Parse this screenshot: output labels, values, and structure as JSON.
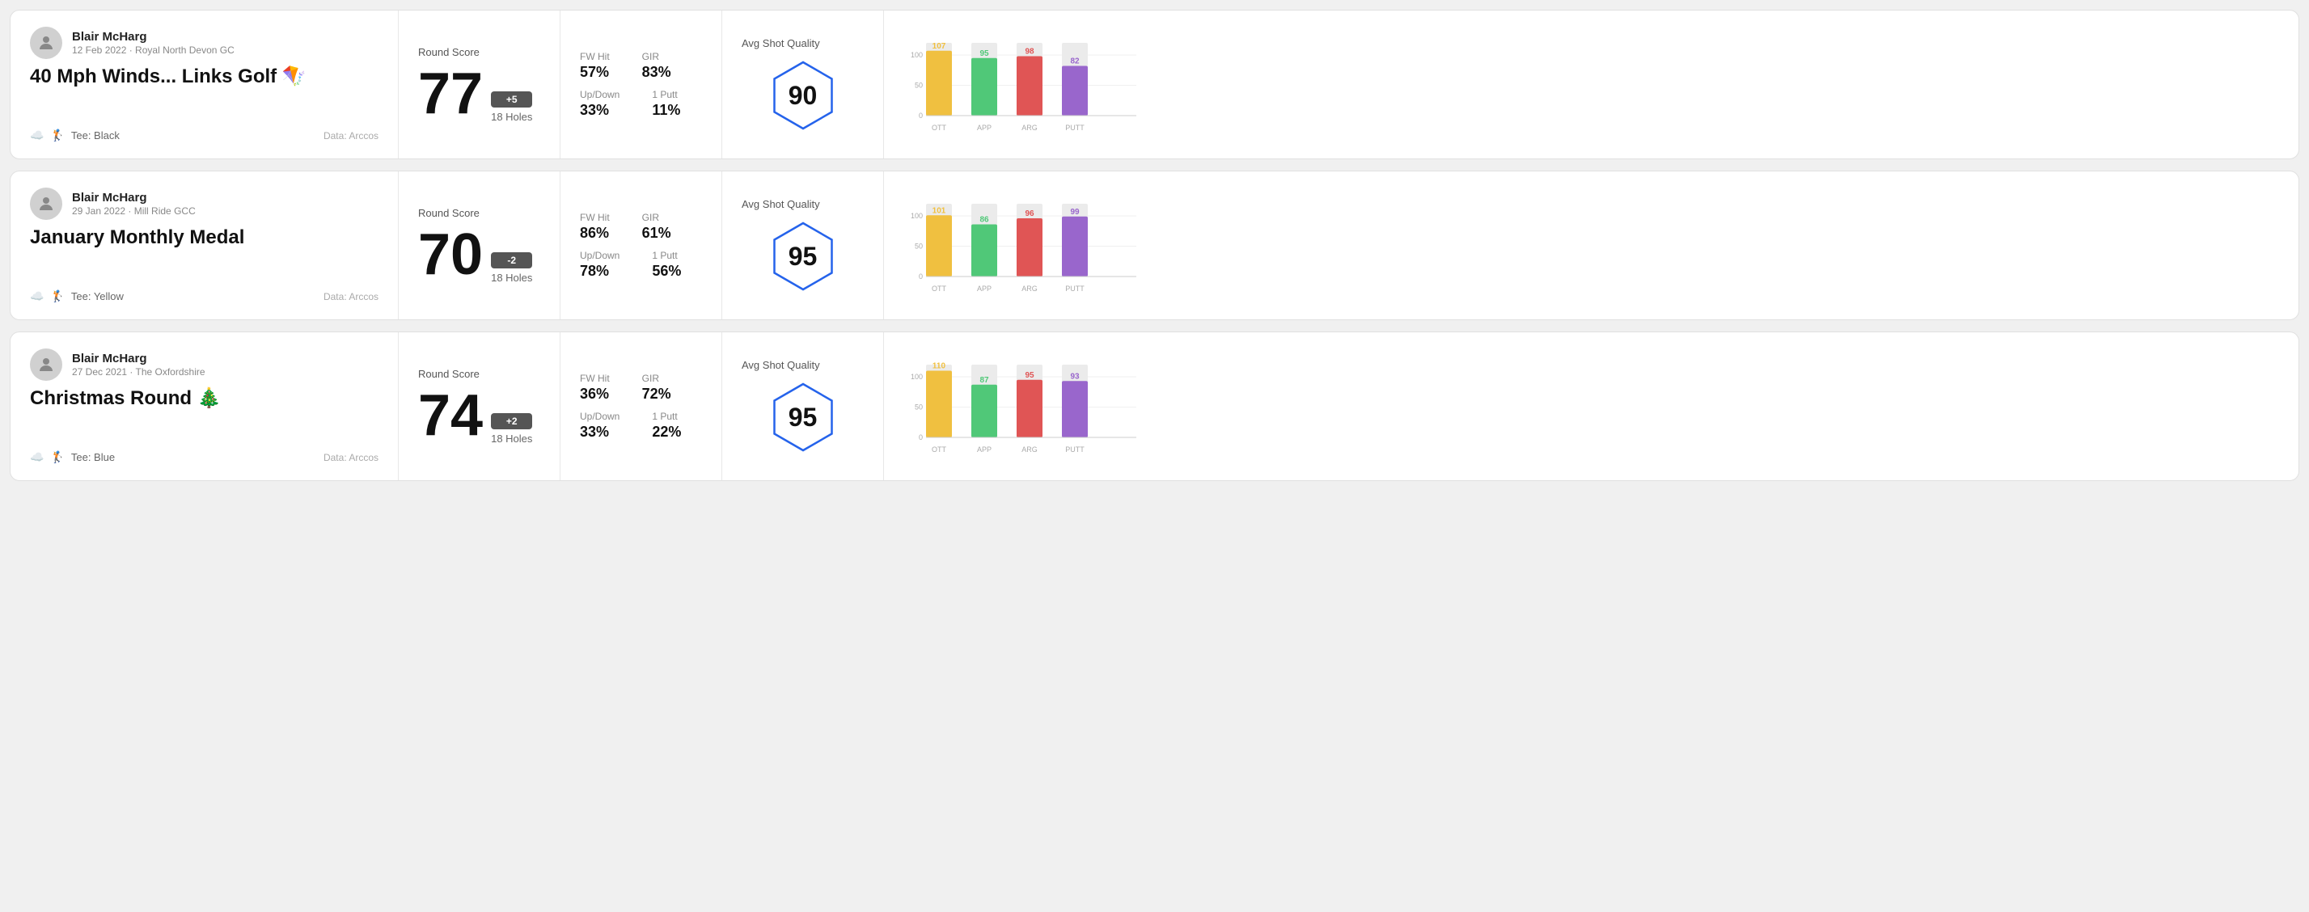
{
  "rounds": [
    {
      "id": "round-1",
      "user": {
        "name": "Blair McHarg",
        "date": "12 Feb 2022 · Royal North Devon GC"
      },
      "title": "40 Mph Winds... Links Golf 🪁",
      "tee": "Black",
      "data_source": "Data: Arccos",
      "score": {
        "label": "Round Score",
        "number": "77",
        "badge": "+5",
        "holes": "18 Holes"
      },
      "stats": {
        "fw_hit_label": "FW Hit",
        "fw_hit_value": "57%",
        "gir_label": "GIR",
        "gir_value": "83%",
        "updown_label": "Up/Down",
        "updown_value": "33%",
        "oneputt_label": "1 Putt",
        "oneputt_value": "11%"
      },
      "quality": {
        "label": "Avg Shot Quality",
        "score": "90"
      },
      "chart": {
        "bars": [
          {
            "label": "OTT",
            "value": 107,
            "color": "#f0c040"
          },
          {
            "label": "APP",
            "value": 95,
            "color": "#50c878"
          },
          {
            "label": "ARG",
            "value": 98,
            "color": "#e05555"
          },
          {
            "label": "PUTT",
            "value": 82,
            "color": "#9966cc"
          }
        ],
        "max": 120,
        "y_labels": [
          "100",
          "50",
          "0"
        ]
      }
    },
    {
      "id": "round-2",
      "user": {
        "name": "Blair McHarg",
        "date": "29 Jan 2022 · Mill Ride GCC"
      },
      "title": "January Monthly Medal",
      "tee": "Yellow",
      "data_source": "Data: Arccos",
      "score": {
        "label": "Round Score",
        "number": "70",
        "badge": "-2",
        "holes": "18 Holes"
      },
      "stats": {
        "fw_hit_label": "FW Hit",
        "fw_hit_value": "86%",
        "gir_label": "GIR",
        "gir_value": "61%",
        "updown_label": "Up/Down",
        "updown_value": "78%",
        "oneputt_label": "1 Putt",
        "oneputt_value": "56%"
      },
      "quality": {
        "label": "Avg Shot Quality",
        "score": "95"
      },
      "chart": {
        "bars": [
          {
            "label": "OTT",
            "value": 101,
            "color": "#f0c040"
          },
          {
            "label": "APP",
            "value": 86,
            "color": "#50c878"
          },
          {
            "label": "ARG",
            "value": 96,
            "color": "#e05555"
          },
          {
            "label": "PUTT",
            "value": 99,
            "color": "#9966cc"
          }
        ],
        "max": 120,
        "y_labels": [
          "100",
          "50",
          "0"
        ]
      }
    },
    {
      "id": "round-3",
      "user": {
        "name": "Blair McHarg",
        "date": "27 Dec 2021 · The Oxfordshire"
      },
      "title": "Christmas Round 🎄",
      "tee": "Blue",
      "data_source": "Data: Arccos",
      "score": {
        "label": "Round Score",
        "number": "74",
        "badge": "+2",
        "holes": "18 Holes"
      },
      "stats": {
        "fw_hit_label": "FW Hit",
        "fw_hit_value": "36%",
        "gir_label": "GIR",
        "gir_value": "72%",
        "updown_label": "Up/Down",
        "updown_value": "33%",
        "oneputt_label": "1 Putt",
        "oneputt_value": "22%"
      },
      "quality": {
        "label": "Avg Shot Quality",
        "score": "95"
      },
      "chart": {
        "bars": [
          {
            "label": "OTT",
            "value": 110,
            "color": "#f0c040"
          },
          {
            "label": "APP",
            "value": 87,
            "color": "#50c878"
          },
          {
            "label": "ARG",
            "value": 95,
            "color": "#e05555"
          },
          {
            "label": "PUTT",
            "value": 93,
            "color": "#9966cc"
          }
        ],
        "max": 120,
        "y_labels": [
          "100",
          "50",
          "0"
        ]
      }
    }
  ]
}
